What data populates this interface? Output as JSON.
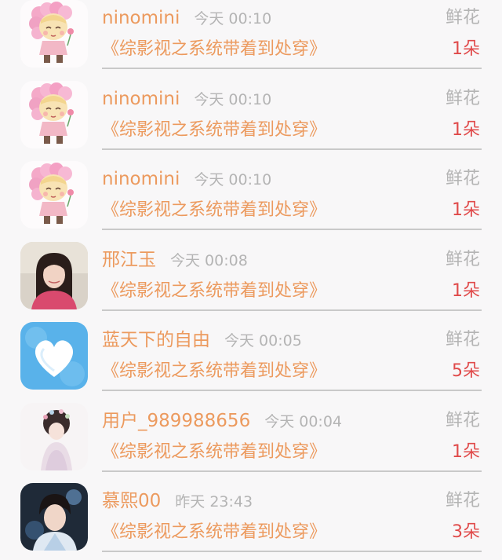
{
  "gifts": [
    {
      "avatar": "cartoon-girl-avatar",
      "name": "ninomini",
      "time": "今天 00:10",
      "gift_label": "鲜花",
      "book": "《综影视之系统带着到处穿》",
      "count": "1朵"
    },
    {
      "avatar": "cartoon-girl-avatar",
      "name": "ninomini",
      "time": "今天 00:10",
      "gift_label": "鲜花",
      "book": "《综影视之系统带着到处穿》",
      "count": "1朵"
    },
    {
      "avatar": "cartoon-girl-avatar",
      "name": "ninomini",
      "time": "今天 00:10",
      "gift_label": "鲜花",
      "book": "《综影视之系统带着到处穿》",
      "count": "1朵"
    },
    {
      "avatar": "photo-girl-avatar",
      "name": "邢江玉",
      "time": "今天 00:08",
      "gift_label": "鲜花",
      "book": "《综影视之系统带着到处穿》",
      "count": "1朵"
    },
    {
      "avatar": "heart-cloud-avatar",
      "name": "蓝天下的自由",
      "time": "今天 00:05",
      "gift_label": "鲜花",
      "book": "《综影视之系统带着到处穿》",
      "count": "5朵"
    },
    {
      "avatar": "illustrated-girl-avatar",
      "name": "用户_989988656",
      "time": "今天 00:04",
      "gift_label": "鲜花",
      "book": "《综影视之系统带着到处穿》",
      "count": "1朵"
    },
    {
      "avatar": "photo-boy-avatar",
      "name": "慕熙00",
      "time": "昨天 23:43",
      "gift_label": "鲜花",
      "book": "《综影视之系统带着到处穿》",
      "count": "3朵"
    }
  ],
  "colors": {
    "name": "#ec9a5e",
    "book": "#ec9a5e",
    "count": "#e04a4a",
    "muted": "#b4b4b4"
  }
}
